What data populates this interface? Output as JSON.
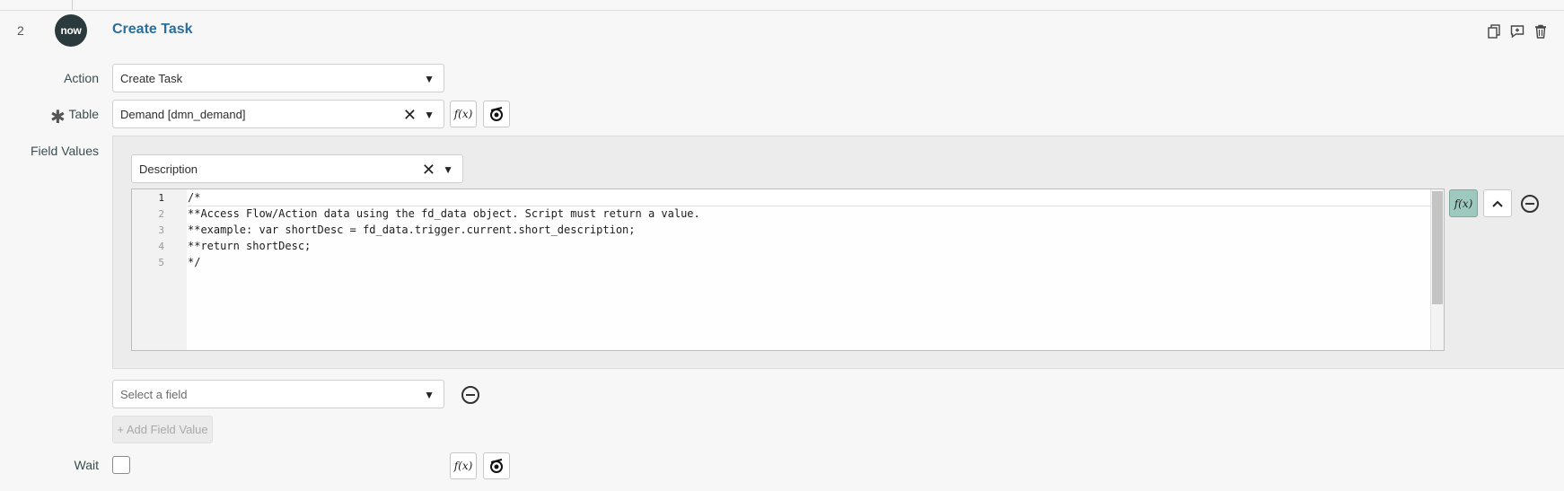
{
  "step": {
    "number": "2",
    "logo_text": "now",
    "title": "Create Task",
    "toolbar_icons": [
      "copy-icon",
      "add-comment-icon",
      "trash-icon"
    ]
  },
  "action": {
    "label": "Action",
    "value": "Create Task"
  },
  "table": {
    "label": "Table",
    "required_mark": "✱",
    "value": "Demand [dmn_demand]"
  },
  "field_values": {
    "label": "Field Values",
    "field_select": "Description",
    "script": {
      "line_numbers": [
        "1",
        "2",
        "3",
        "4",
        "5"
      ],
      "lines": [
        "/*",
        "**Access Flow/Action data using the fd_data object. Script must return a value.",
        "**example: var shortDesc = fd_data.trigger.current.short_description;",
        "**return shortDesc;",
        "*/"
      ]
    },
    "new_field_placeholder": "Select a field",
    "add_button": "+ Add Field Value"
  },
  "wait": {
    "label": "Wait"
  },
  "buttons": {
    "fx": "f(x)"
  }
}
